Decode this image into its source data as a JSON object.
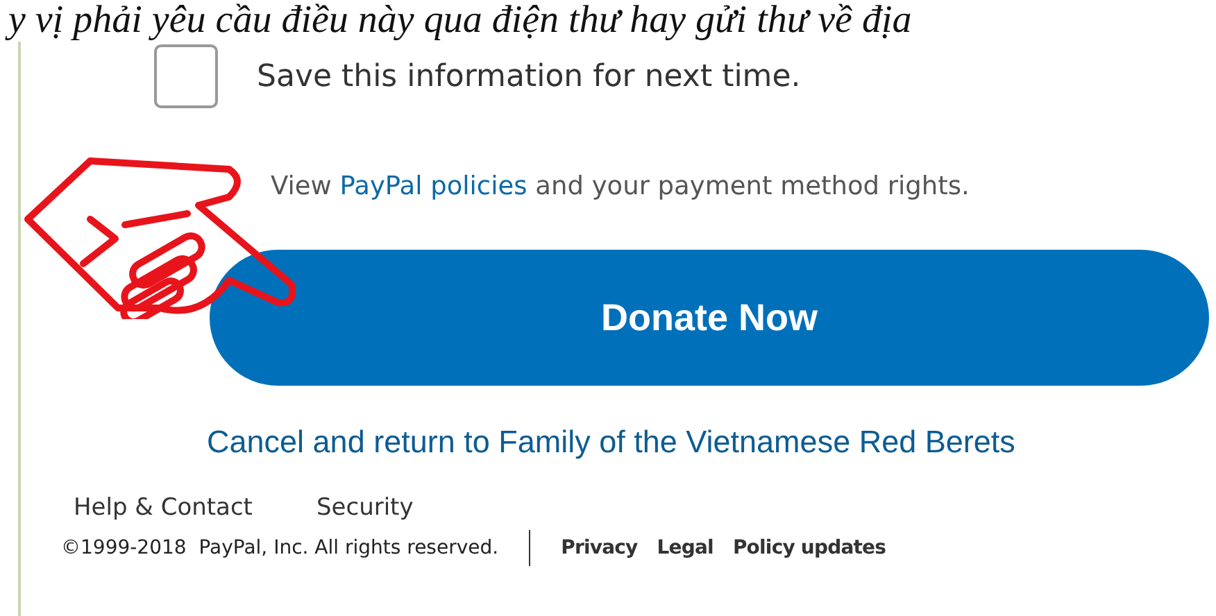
{
  "caption": "y vị phải yêu cầu điều này qua điện thư hay gửi thư về địa",
  "save_option": {
    "label": "Save this information for next time.",
    "checked": false
  },
  "policies": {
    "before": "View ",
    "link": "PayPal policies",
    "after": " and your payment method rights."
  },
  "donate_button": "Donate Now",
  "cancel_link": "Cancel and return to Family of the Vietnamese Red Berets",
  "footer": {
    "links": [
      "Help & Contact",
      "Security"
    ],
    "copyright": "©1999-2018  PayPal, Inc. All rights reserved.",
    "legal_links": [
      "Privacy",
      "Legal",
      "Policy updates"
    ]
  }
}
